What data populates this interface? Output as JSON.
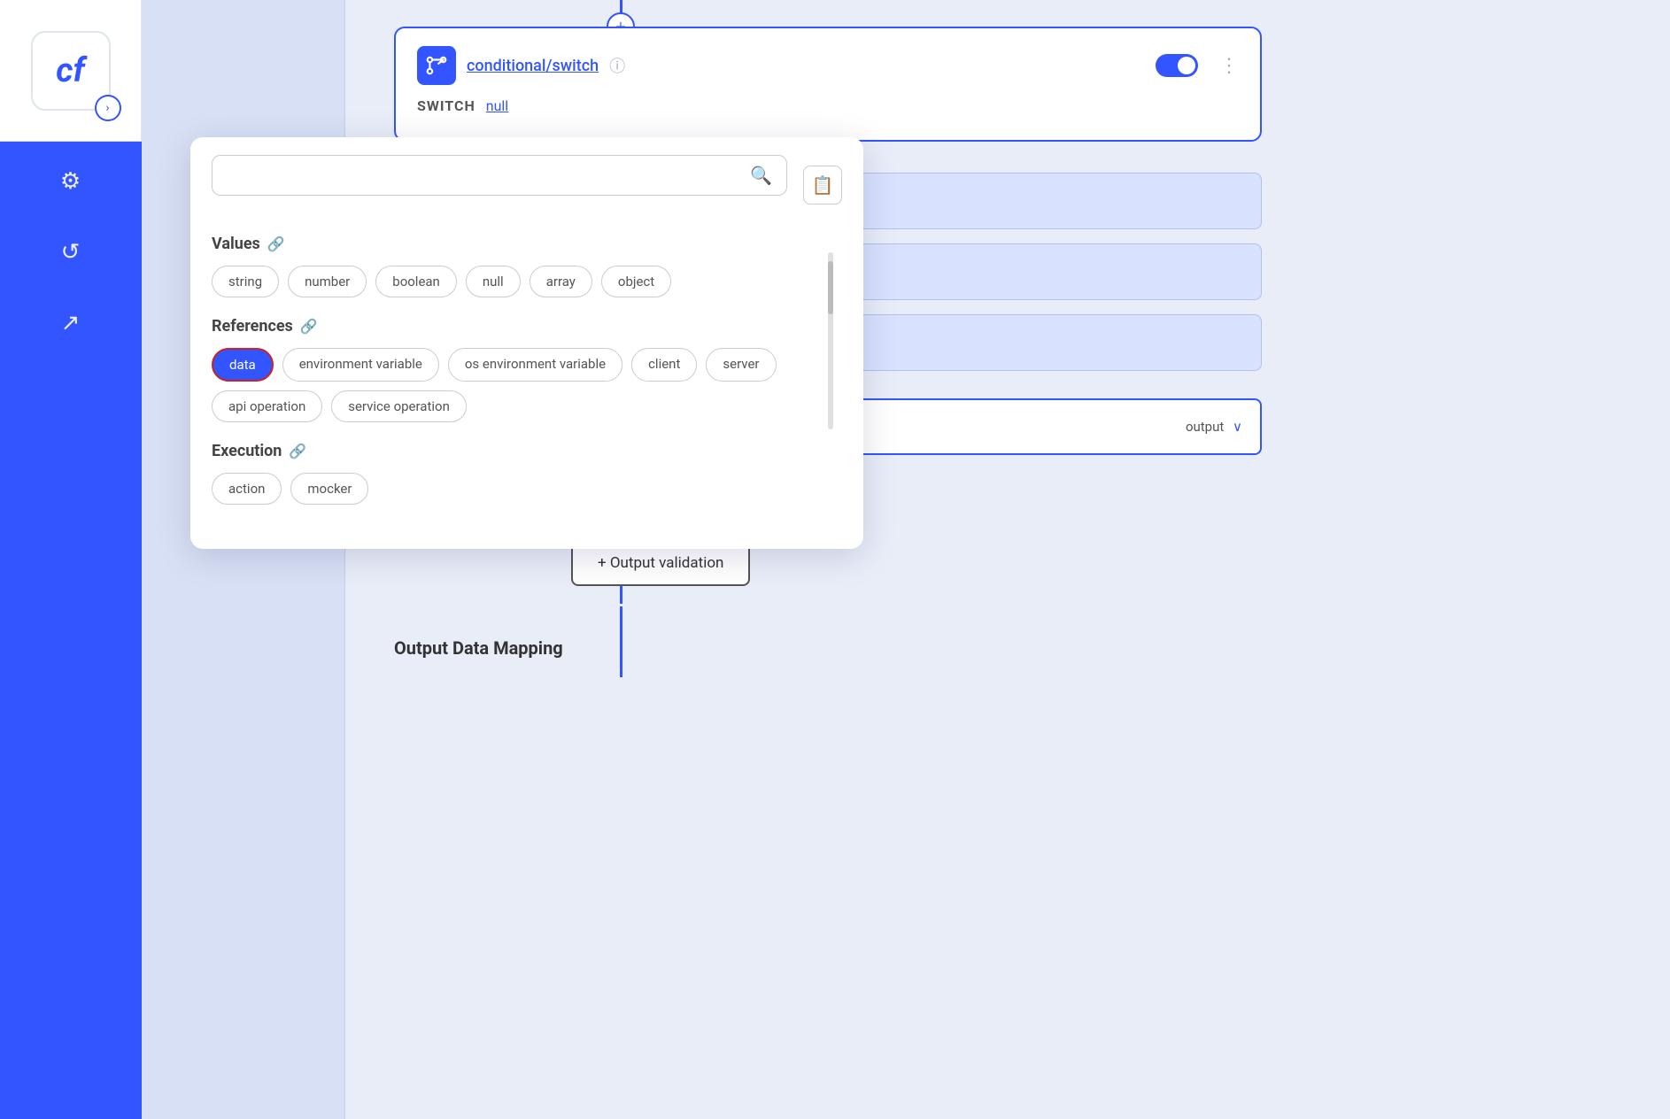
{
  "sidebar": {
    "logo_text": "cf",
    "expand_icon": "›",
    "icons": [
      {
        "name": "settings-icon",
        "symbol": "⚙",
        "label": "Settings"
      },
      {
        "name": "history-icon",
        "symbol": "↺",
        "label": "History"
      },
      {
        "name": "export-icon",
        "symbol": "↗",
        "label": "Export"
      }
    ]
  },
  "canvas": {
    "node": {
      "title": "conditional/switch",
      "switch_label": "SWITCH",
      "switch_value": "null",
      "toggle_state": "on"
    },
    "output_label": "output",
    "output_validation_btn": "+ Output validation",
    "output_mapping_label": "Output Data Mapping"
  },
  "popup": {
    "search_placeholder": "",
    "sections": [
      {
        "id": "values",
        "title": "Values",
        "has_link_icon": true,
        "tags": [
          {
            "id": "string",
            "label": "string",
            "active": false
          },
          {
            "id": "number",
            "label": "number",
            "active": false
          },
          {
            "id": "boolean",
            "label": "boolean",
            "active": false
          },
          {
            "id": "null",
            "label": "null",
            "active": false
          },
          {
            "id": "array",
            "label": "array",
            "active": false
          },
          {
            "id": "object",
            "label": "object",
            "active": false
          }
        ]
      },
      {
        "id": "references",
        "title": "References",
        "has_link_icon": true,
        "tags": [
          {
            "id": "data",
            "label": "data",
            "active": true
          },
          {
            "id": "environment-variable",
            "label": "environment variable",
            "active": false
          },
          {
            "id": "os-environment-variable",
            "label": "os environment variable",
            "active": false
          },
          {
            "id": "client",
            "label": "client",
            "active": false
          },
          {
            "id": "server",
            "label": "server",
            "active": false
          },
          {
            "id": "api-operation",
            "label": "api operation",
            "active": false
          },
          {
            "id": "service-operation",
            "label": "service operation",
            "active": false
          }
        ]
      },
      {
        "id": "execution",
        "title": "Execution",
        "has_link_icon": true,
        "tags": [
          {
            "id": "action",
            "label": "action",
            "active": false
          },
          {
            "id": "mocker",
            "label": "mocker",
            "active": false
          }
        ]
      }
    ]
  }
}
